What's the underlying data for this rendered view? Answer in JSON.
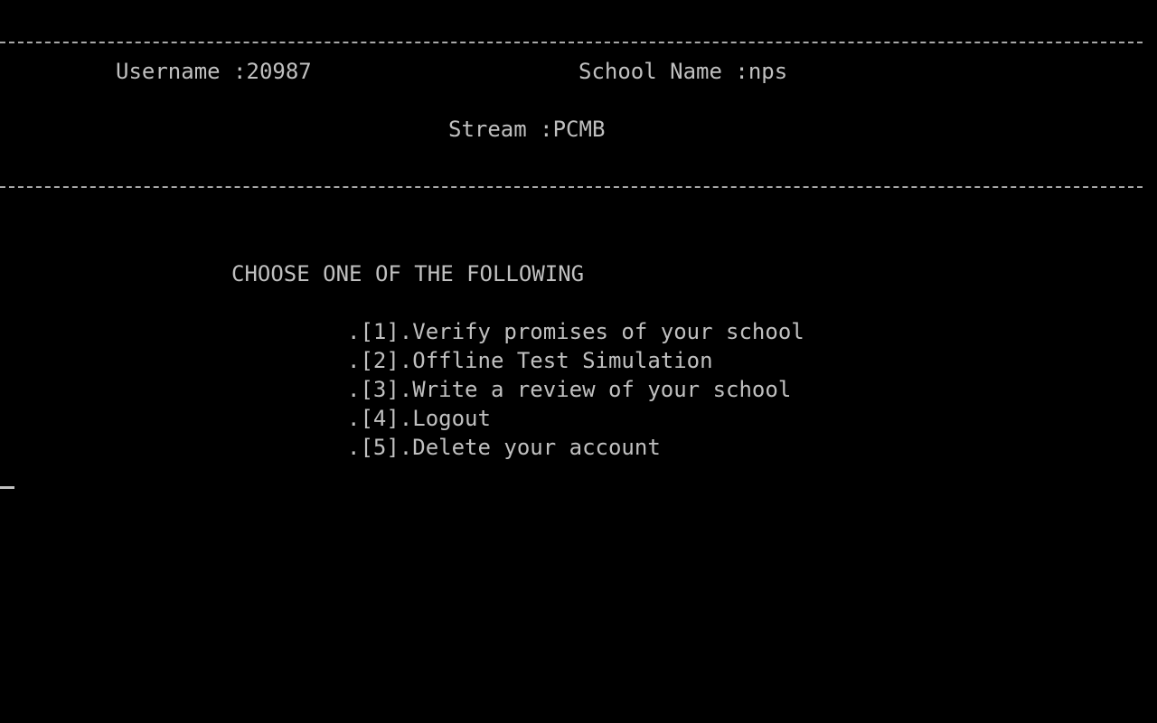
{
  "header": {
    "username_label": "Username :",
    "username_value": "20987",
    "school_label": "School Name :",
    "school_value": "nps",
    "stream_label": "Stream :",
    "stream_value": "PCMB"
  },
  "menu": {
    "heading": "CHOOSE ONE OF THE FOLLOWING",
    "items": [
      {
        "label": ".[1].Verify promises of your school"
      },
      {
        "label": ".[2].Offline Test Simulation"
      },
      {
        "label": ".[3].Write a review of your school"
      },
      {
        "label": ".[4].Logout"
      },
      {
        "label": ".[5].Delete your account"
      }
    ]
  },
  "colors": {
    "background": "#000000",
    "text": "#c0c0c0"
  }
}
